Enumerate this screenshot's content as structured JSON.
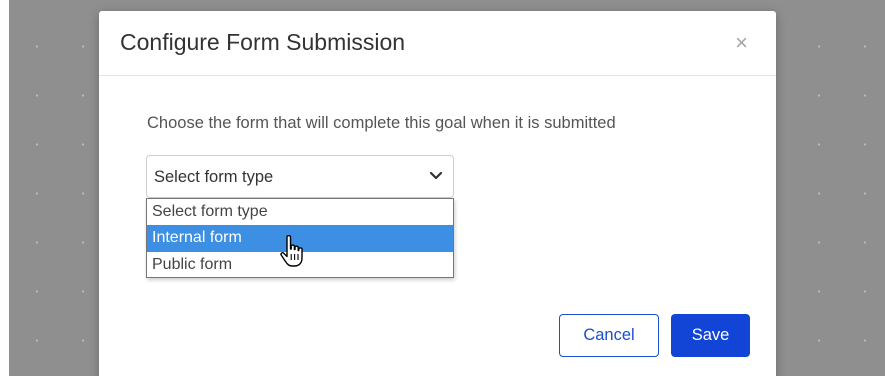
{
  "modal": {
    "title": "Configure Form Submission",
    "close_glyph": "×",
    "prompt": "Choose the form that will complete this goal when it is submitted"
  },
  "form_type_select": {
    "value": "Select form type",
    "options": [
      "Select form type",
      "Internal form",
      "Public form"
    ],
    "highlighted_index": 1
  },
  "footer": {
    "cancel_label": "Cancel",
    "save_label": "Save"
  },
  "colors": {
    "primary": "#1245d6",
    "highlight": "#3d8fe4",
    "backdrop": "#8f8f8f"
  },
  "icons": {
    "close": "close-icon",
    "chevron": "chevron-down-icon",
    "cursor": "hand-pointer-icon"
  }
}
